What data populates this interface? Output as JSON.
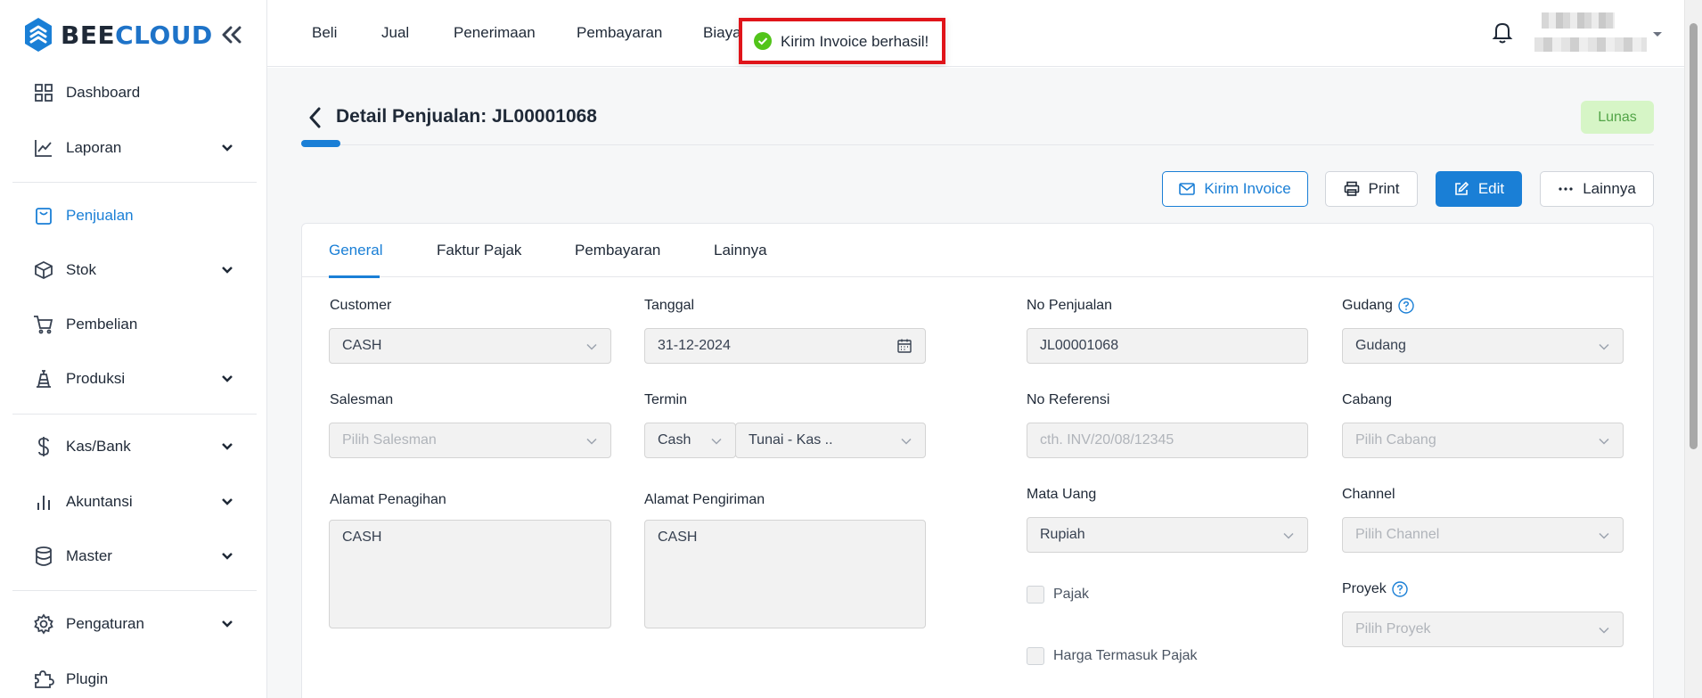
{
  "brand": {
    "name_part1": "BEE",
    "name_part2": "CLOUD"
  },
  "sidebar": {
    "items": [
      {
        "label": "Dashboard",
        "icon": "dashboard-icon"
      },
      {
        "label": "Laporan",
        "icon": "chart-icon"
      },
      {
        "label": "Penjualan",
        "icon": "bag-icon"
      },
      {
        "label": "Stok",
        "icon": "box-icon"
      },
      {
        "label": "Pembelian",
        "icon": "cart-icon"
      },
      {
        "label": "Produksi",
        "icon": "factory-icon"
      },
      {
        "label": "Kas/Bank",
        "icon": "dollar-icon"
      },
      {
        "label": "Akuntansi",
        "icon": "bar-chart-icon"
      },
      {
        "label": "Master",
        "icon": "database-icon"
      },
      {
        "label": "Pengaturan",
        "icon": "gear-icon"
      },
      {
        "label": "Plugin",
        "icon": "puzzle-icon"
      }
    ],
    "active": "Penjualan"
  },
  "topnav": {
    "tabs": [
      "Beli",
      "Jual",
      "Penerimaan",
      "Pembayaran",
      "Biaya"
    ]
  },
  "toast": {
    "message": "Kirim Invoice berhasil!"
  },
  "page": {
    "title": "Detail Penjualan: JL00001068",
    "status": "Lunas"
  },
  "actions": {
    "send_invoice": "Kirim Invoice",
    "print": "Print",
    "edit": "Edit",
    "more": "Lainnya"
  },
  "tabs": [
    "General",
    "Faktur Pajak",
    "Pembayaran",
    "Lainnya"
  ],
  "form": {
    "customer": {
      "label": "Customer",
      "value": "CASH"
    },
    "tanggal": {
      "label": "Tanggal",
      "value": "31-12-2024"
    },
    "no_penjualan": {
      "label": "No Penjualan",
      "value": "JL00001068"
    },
    "gudang": {
      "label": "Gudang",
      "value": "Gudang"
    },
    "salesman": {
      "label": "Salesman",
      "placeholder": "Pilih Salesman"
    },
    "termin": {
      "label": "Termin",
      "value": "Cash",
      "value2": "Tunai - Kas .."
    },
    "no_referensi": {
      "label": "No Referensi",
      "placeholder": "cth. INV/20/08/12345"
    },
    "cabang": {
      "label": "Cabang",
      "placeholder": "Pilih Cabang"
    },
    "alamat_penagihan": {
      "label": "Alamat Penagihan",
      "value": "CASH"
    },
    "alamat_pengiriman": {
      "label": "Alamat Pengiriman",
      "value": "CASH"
    },
    "mata_uang": {
      "label": "Mata Uang",
      "value": "Rupiah"
    },
    "channel": {
      "label": "Channel",
      "placeholder": "Pilih Channel"
    },
    "pajak": {
      "label": "Pajak"
    },
    "proyek": {
      "label": "Proyek",
      "placeholder": "Pilih Proyek"
    },
    "harga_termasuk_pajak": {
      "label": "Harga Termasuk Pajak"
    }
  },
  "colors": {
    "accent": "#1a7fd6",
    "status_bg": "#d6f5c6",
    "status_text": "#52a447",
    "toast_border": "#e0141a",
    "toast_icon": "#52c41a"
  }
}
